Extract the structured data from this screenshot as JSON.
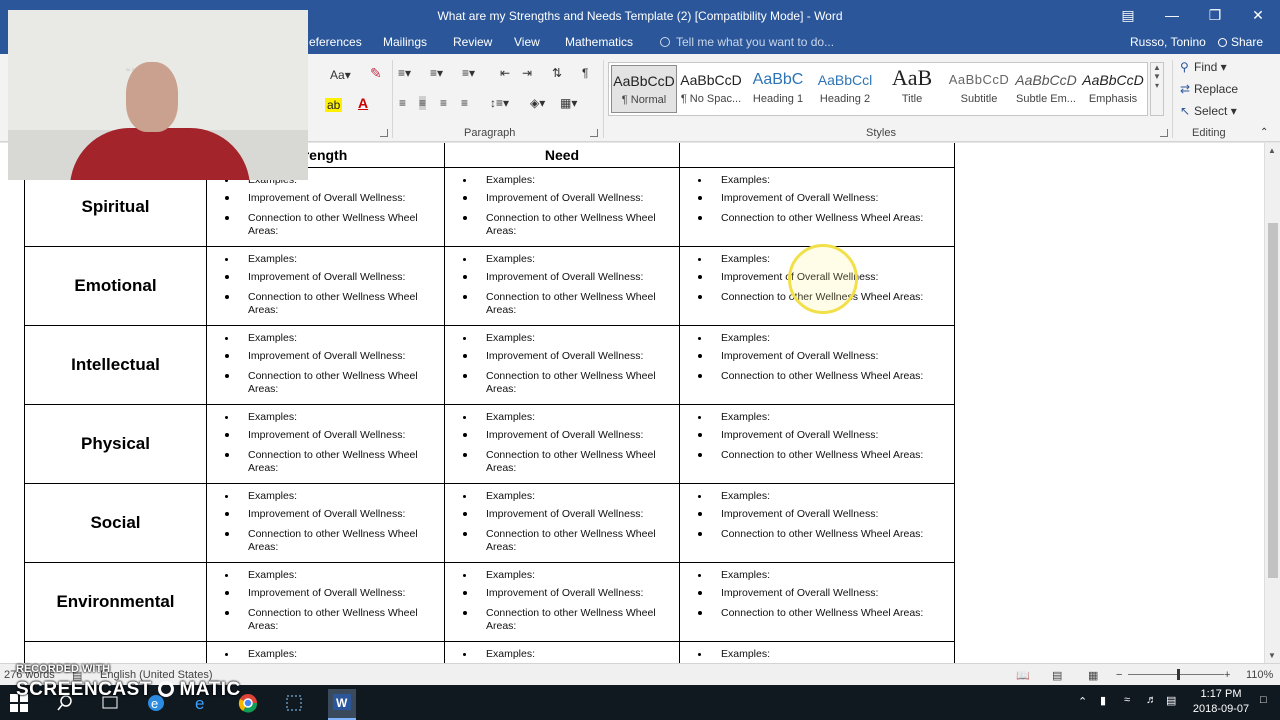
{
  "window": {
    "title": "What are my Strengths and Needs Template (2) [Compatibility Mode] - Word"
  },
  "tabs": {
    "references": "eferences",
    "mailings": "Mailings",
    "review": "Review",
    "view": "View",
    "mathematics": "Mathematics"
  },
  "tell_me": {
    "placeholder": "Tell me what you want to do..."
  },
  "user": {
    "name": "Russo, Tonino",
    "share": "Share"
  },
  "ribbon": {
    "groups": {
      "paragraph": "Paragraph",
      "styles": "Styles",
      "editing": "Editing"
    },
    "styles": [
      {
        "sample": "AaBbCcD",
        "name": "¶ Normal"
      },
      {
        "sample": "AaBbCcD",
        "name": "¶ No Spac..."
      },
      {
        "sample": "AaBbC",
        "name": "Heading 1"
      },
      {
        "sample": "AaBbCcl",
        "name": "Heading 2"
      },
      {
        "sample": "AaB",
        "name": "Title"
      },
      {
        "sample": "AaBbCcD",
        "name": "Subtitle"
      },
      {
        "sample": "AaBbCcD",
        "name": "Subtle Em..."
      },
      {
        "sample": "AaBbCcD",
        "name": "Emphasis"
      }
    ],
    "editing": {
      "find": "Find",
      "replace": "Replace",
      "select": "Select"
    },
    "font_size_label": "Aa"
  },
  "table": {
    "headers": [
      "",
      "rength",
      "Need",
      ""
    ],
    "bullet_lines": {
      "examples": "Examples:",
      "improvement": "Improvement of Overall Wellness:",
      "connection": "Connection to other Wellness Wheel Areas:"
    },
    "rows": [
      "Spiritual",
      "Emotional",
      "Intellectual",
      "Physical",
      "Social",
      "Environmental"
    ]
  },
  "status": {
    "words": "276 words",
    "language": "English (United States)",
    "zoom": "110%",
    "zoom_level": 1.1
  },
  "taskbar": {
    "time": "1:17 PM",
    "date": "2018-09-07"
  },
  "overlay": {
    "line1": "RECORDED WITH",
    "line2": "SCREENCAST",
    "line3": "MATIC"
  }
}
